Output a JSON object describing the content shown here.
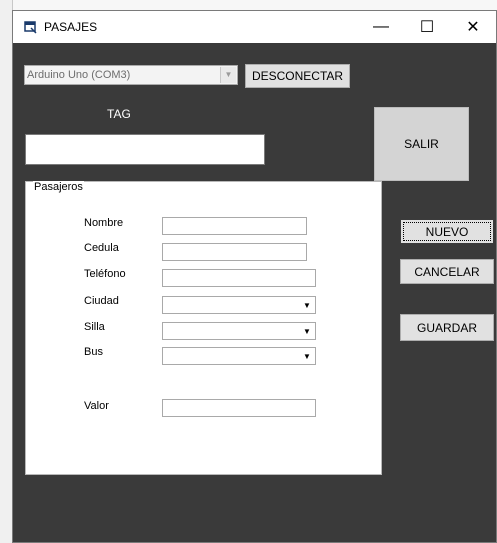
{
  "window": {
    "title": "PASAJES",
    "minimize_glyph": "—",
    "maximize_glyph": "☐",
    "close_glyph": "✕",
    "background": "#3a3a3a"
  },
  "connection": {
    "port_value": "Arduino Uno (COM3)",
    "disconnect_label": "DESCONECTAR"
  },
  "tag": {
    "label": "TAG",
    "value": ""
  },
  "buttons": {
    "exit_label": "SALIR",
    "new_label": "NUEVO",
    "cancel_label": "CANCELAR",
    "save_label": "GUARDAR"
  },
  "pasajeros": {
    "legend": "Pasajeros",
    "fields": {
      "nombre": {
        "label": "Nombre",
        "value": ""
      },
      "cedula": {
        "label": "Cedula",
        "value": ""
      },
      "telefono": {
        "label": "Teléfono",
        "value": ""
      },
      "ciudad": {
        "label": "Ciudad",
        "value": ""
      },
      "silla": {
        "label": "Silla",
        "value": ""
      },
      "bus": {
        "label": "Bus",
        "value": ""
      },
      "valor": {
        "label": "Valor",
        "value": ""
      }
    }
  },
  "icons": {
    "app": "app-window-icon",
    "dropdown": "chevron-down-icon"
  }
}
